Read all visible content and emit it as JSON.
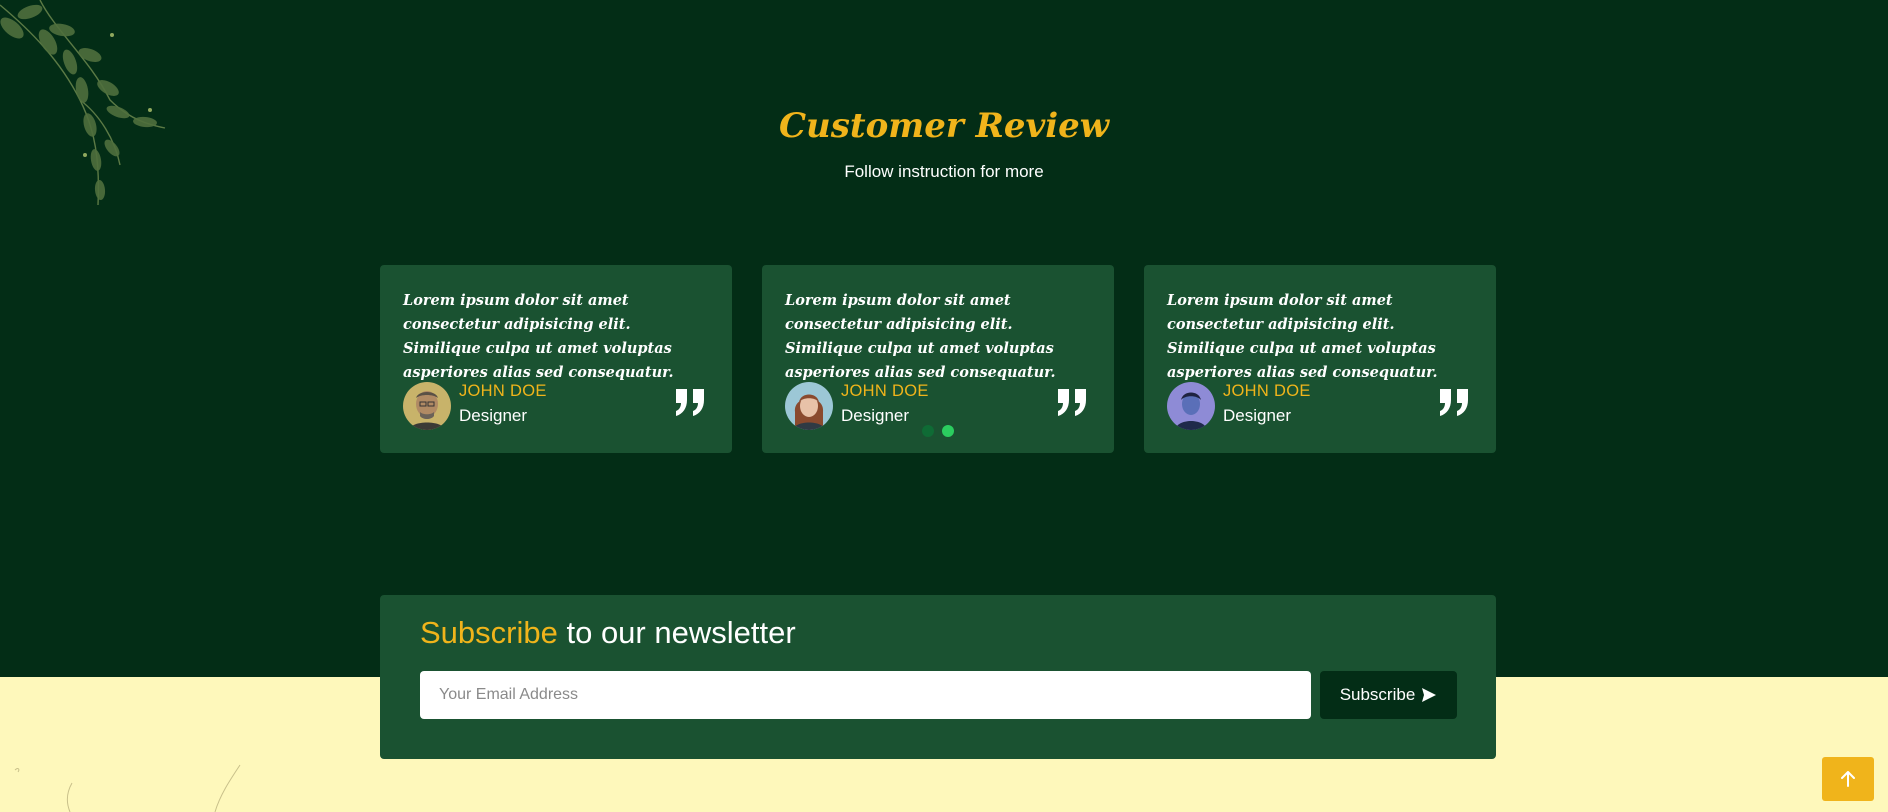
{
  "colors": {
    "background_dark": "#032d16",
    "card": "#1a5231",
    "accent": "#f0b41b",
    "background_light": "#fef8bb",
    "dot_active": "#2bcd5f"
  },
  "review_section": {
    "title": "Customer Review",
    "subtitle": "Follow instruction for more",
    "cards": [
      {
        "text": "Lorem ipsum dolor sit amet consectetur adipisicing elit. Similique culpa ut amet voluptas asperiores alias sed consequatur.",
        "name": "JOHN DOE",
        "role": "Designer",
        "icon": "quote-icon"
      },
      {
        "text": "Lorem ipsum dolor sit amet consectetur adipisicing elit. Similique culpa ut amet voluptas asperiores alias sed consequatur.",
        "name": "JOHN DOE",
        "role": "Designer",
        "icon": "quote-icon"
      },
      {
        "text": "Lorem ipsum dolor sit amet consectetur adipisicing elit. Similique culpa ut amet voluptas asperiores alias sed consequatur.",
        "name": "JOHN DOE",
        "role": "Designer",
        "icon": "quote-icon"
      }
    ],
    "pagination": {
      "total": 2,
      "active": 2
    }
  },
  "newsletter": {
    "title_accent": "Subscribe",
    "title_rest": " to our newsletter",
    "email_placeholder": "Your Email Address",
    "button_label": "Subscribe",
    "button_icon": "send-icon"
  },
  "scroll_top": {
    "icon": "arrow-up-icon"
  }
}
